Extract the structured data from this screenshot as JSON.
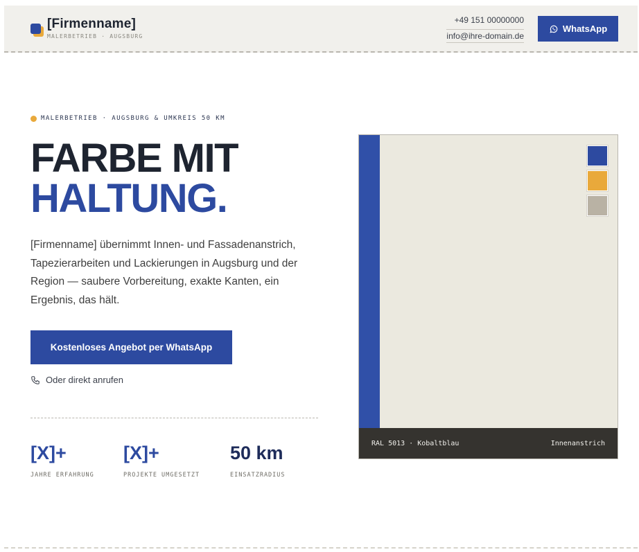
{
  "header": {
    "brand_name": "[Firmenname]",
    "brand_sub": "MALERBETRIEB · AUGSBURG",
    "phone": "+49 151 00000000",
    "email": "info@ihre-domain.de",
    "whatsapp_label": "WhatsApp"
  },
  "hero": {
    "tagline": "MALERBETRIEB · AUGSBURG & UMKREIS 50 KM",
    "headline_line1": "FARBE MIT",
    "headline_line2": "HALTUNG.",
    "lead": "[Firmenname] übernimmt Innen- und Fassadenanstrich, Tapezierarbeiten und Lackierungen in Augsburg und der Region — saubere Vorbereitung, exakte Kanten, ein Ergebnis, das hält.",
    "cta_label": "Kostenloses Angebot per WhatsApp",
    "call_label": "Oder direkt anrufen"
  },
  "stats": [
    {
      "value": "[X]+",
      "label": "JAHRE ERFAHRUNG"
    },
    {
      "value": "[X]+",
      "label": "PROJEKTE UMGESETZT"
    },
    {
      "value": "50 km",
      "label": "EINSATZRADIUS"
    }
  ],
  "card": {
    "caption_left": "RAL 5013 · Kobaltblau",
    "caption_right": "Innenanstrich",
    "swatches": [
      "#2d4aa0",
      "#e9a93b",
      "#b9b2a4"
    ]
  },
  "colors": {
    "accent_blue": "#2d4aa0",
    "accent_yellow": "#e9a93b",
    "header_bg": "#f1f0ec"
  }
}
